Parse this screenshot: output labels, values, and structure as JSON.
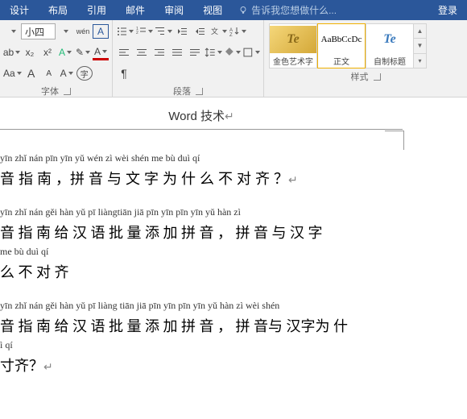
{
  "tabs": {
    "design": "设计",
    "layout": "布局",
    "references": "引用",
    "mailings": "邮件",
    "review": "审阅",
    "view": "视图"
  },
  "tellme": "告诉我您想做什么...",
  "login": "登录",
  "font": {
    "size_label": "小四",
    "wen": "wén",
    "a_boxed": "A",
    "x2": "x₂",
    "x2sup": "x²",
    "aa": "Aa",
    "clear": "A",
    "enclosed": "字",
    "big_a": "A",
    "small_a": "A"
  },
  "groups": {
    "font": "字体",
    "paragraph": "段落",
    "styles": "样式"
  },
  "styles": {
    "gold": "金色艺术字",
    "normal_prev": "AaBbCcDc",
    "normal": "正文",
    "custom": "自制标题"
  },
  "header": "Word 技术",
  "pinyin": {
    "l1": "yīn zhǐ nán   pīn yīn yǔ wén  zì wèi shén me bù duì qí",
    "h1": "音 指 南 ，拼 音 与 文 字 为 什 么 不 对 齐 ？",
    "l2a": "yīn zhǐ nán gěi hàn yǔ  pī  liàngtiān  jiā pīn yīn      pīn yīn  yǔ  hàn  zì",
    "h2a": "音 指 南 给 汉 语 批  量  添  加 拼 音  ，  拼  音 与 汉  字",
    "l2b": "me  bù  duì  qí",
    "h2b": "么 不 对 齐",
    "l3a": "yīn zhǐ nán gěi hàn yǔ pī liàng tiān  jiā pīn yīn   pīn yīn yǔ hàn zì wèi shén",
    "h3a": "音 指 南 给 汉 语 批  量  添 加 拼 音 ， 拼 音与 汉字为 什",
    "l3b": "ì qí",
    "h3b": "寸齐？"
  }
}
